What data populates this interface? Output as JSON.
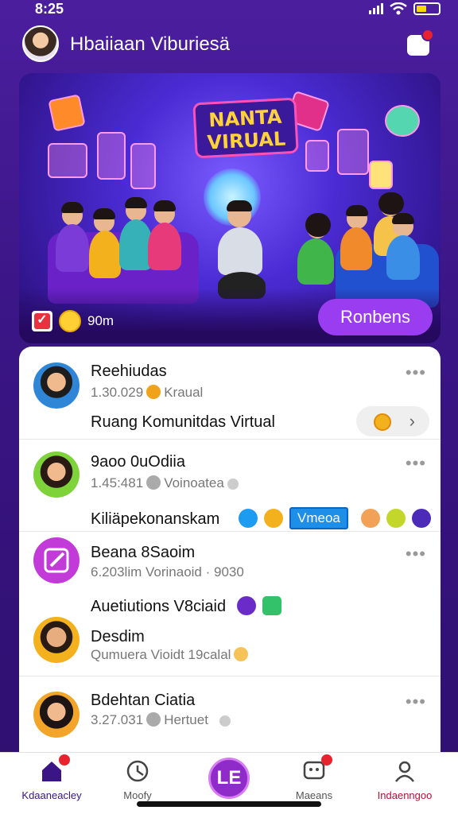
{
  "status_bar": {
    "time": "8:25"
  },
  "header": {
    "title": "Hbaiiaan Viburiesä"
  },
  "banner": {
    "sign_line1": "NANTA",
    "sign_line2": "VIRUAL",
    "count": "90m",
    "cta_label": "Ronbens"
  },
  "feed": {
    "posts": [
      {
        "name": "Reehiudas",
        "meta": "1.30.029",
        "meta_extra": "Kraual",
        "text": "Ruang Komunitdas Virtual"
      },
      {
        "name": "9aoo 0uOdiia",
        "meta": "1.45:481",
        "meta_extra": "Voinoatea",
        "text": "Kiliäpekonanskam",
        "tag": "Vmeoa"
      },
      {
        "name": "Beana 8Saoim",
        "meta": "6.203lim",
        "meta_extra": "Vorinaoid · 9030"
      },
      {
        "text": "Auetiutions V8ciaid"
      },
      {
        "name": "Desdim",
        "meta": "Qumuera Vioidt",
        "meta_extra": "19calal"
      },
      {
        "name": "Bdehtan Ciatia",
        "meta": "3.27.031",
        "meta_extra": "Hertuet"
      }
    ]
  },
  "nav": {
    "items": [
      {
        "label": "Kdaaneacley"
      },
      {
        "label": "Moofy"
      },
      {
        "label": "LE"
      },
      {
        "label": "Maeans"
      },
      {
        "label": "Indaenngoo"
      }
    ]
  },
  "colors": {
    "primary": "#4b1e9e",
    "accent": "#9a3cf0",
    "badge": "#e8222e"
  }
}
